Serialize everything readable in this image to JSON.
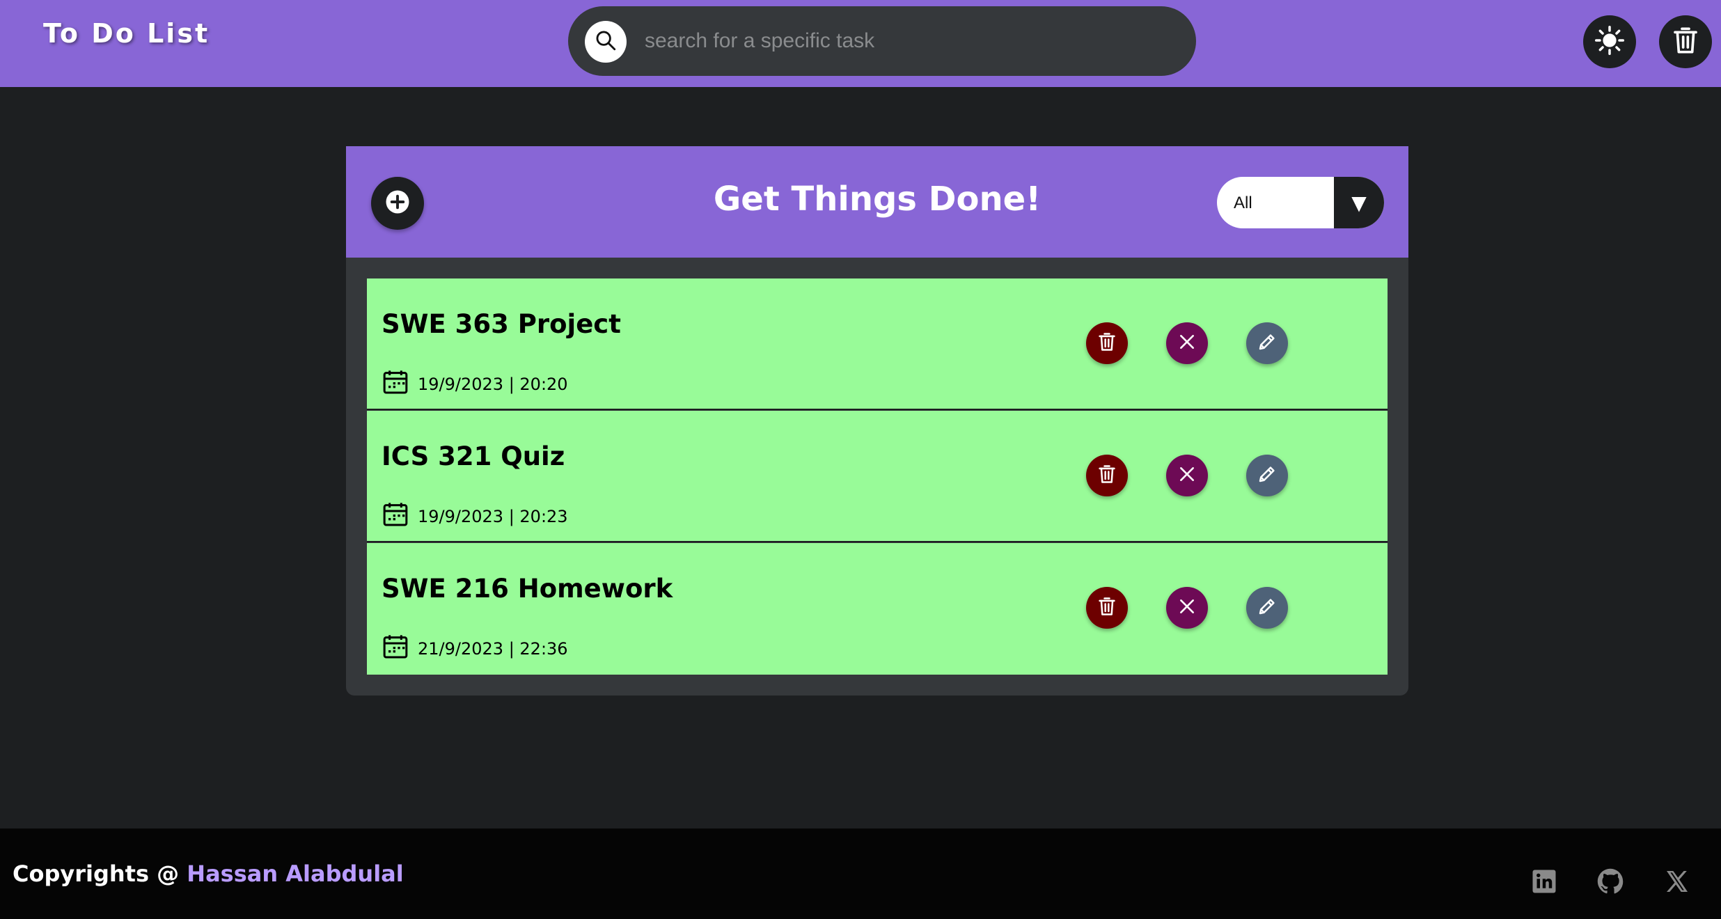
{
  "header": {
    "title": "To Do List",
    "search_placeholder": "search for a specific task",
    "icons": {
      "search": "search-icon",
      "theme": "sun-icon",
      "clear": "trash-icon"
    }
  },
  "card": {
    "title": "Get Things Done!",
    "filter": {
      "selected": "All",
      "arrow": "▼"
    },
    "tasks": [
      {
        "title": "SWE 363 Project",
        "date": "19/9/2023 | 20:20"
      },
      {
        "title": "ICS 321 Quiz",
        "date": "19/9/2023 | 20:23"
      },
      {
        "title": "SWE 216 Homework",
        "date": "21/9/2023 | 22:36"
      }
    ],
    "task_actions": [
      "trash-icon",
      "close-icon",
      "pencil-icon"
    ]
  },
  "footer": {
    "copyright_prefix": "Copyrights @ ",
    "author": "Hassan Alabdulal",
    "social_icons": [
      "linkedin-icon",
      "github-icon",
      "x-icon"
    ]
  },
  "colors": {
    "accent": "#8866d6",
    "background": "#1d1f21",
    "card": "#35383b",
    "task": "#98fb98",
    "delete": "#6d0000",
    "dismiss": "#6d0a55",
    "edit": "#4e6278",
    "author": "#b99cff"
  }
}
